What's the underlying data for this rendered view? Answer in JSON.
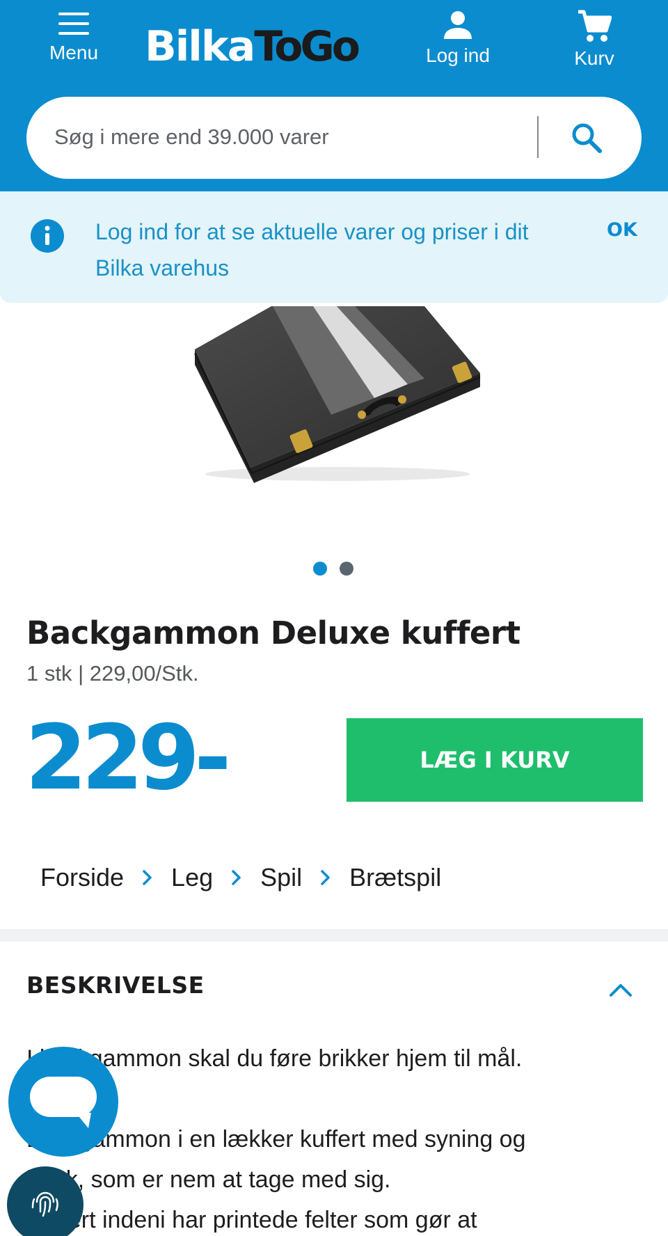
{
  "header": {
    "menu_label": "Menu",
    "logo_part1": "Bilka",
    "logo_part2": "ToGo",
    "login_label": "Log ind",
    "cart_label": "Kurv",
    "background_color": "#0a8ccf"
  },
  "search": {
    "placeholder": "Søg i mere end 39.000 varer",
    "icon": "search-icon"
  },
  "notice": {
    "text": "Log ind for at se aktuelle varer og priser i dit Bilka varehus",
    "ok_label": "OK",
    "icon": "info-icon"
  },
  "carousel": {
    "image_alt": "Backgammon case",
    "page_count": 2,
    "active_index": 0
  },
  "product": {
    "title": "Backgammon Deluxe kuffert",
    "unit_info": "1 stk | 229,00/Stk.",
    "price": "229",
    "price_suffix": "-",
    "add_to_cart_label": "LÆG I KURV"
  },
  "breadcrumb": [
    "Forside",
    "Leg",
    "Spil",
    "Brætspil"
  ],
  "description": {
    "heading": "BESKRIVELSE",
    "lines": [
      "I backgammon skal du føre brikker hjem til mål.",
      "",
      "Backgammon i en lækker kuffert med syning og",
      "hank, som er nem at tage med sig.",
      "Kuffert indeni har printede felter som gør at"
    ]
  },
  "colors": {
    "brand_blue": "#0a8ccf",
    "add_button_green": "#1fbe6d",
    "notice_background": "#e3f4fb"
  }
}
